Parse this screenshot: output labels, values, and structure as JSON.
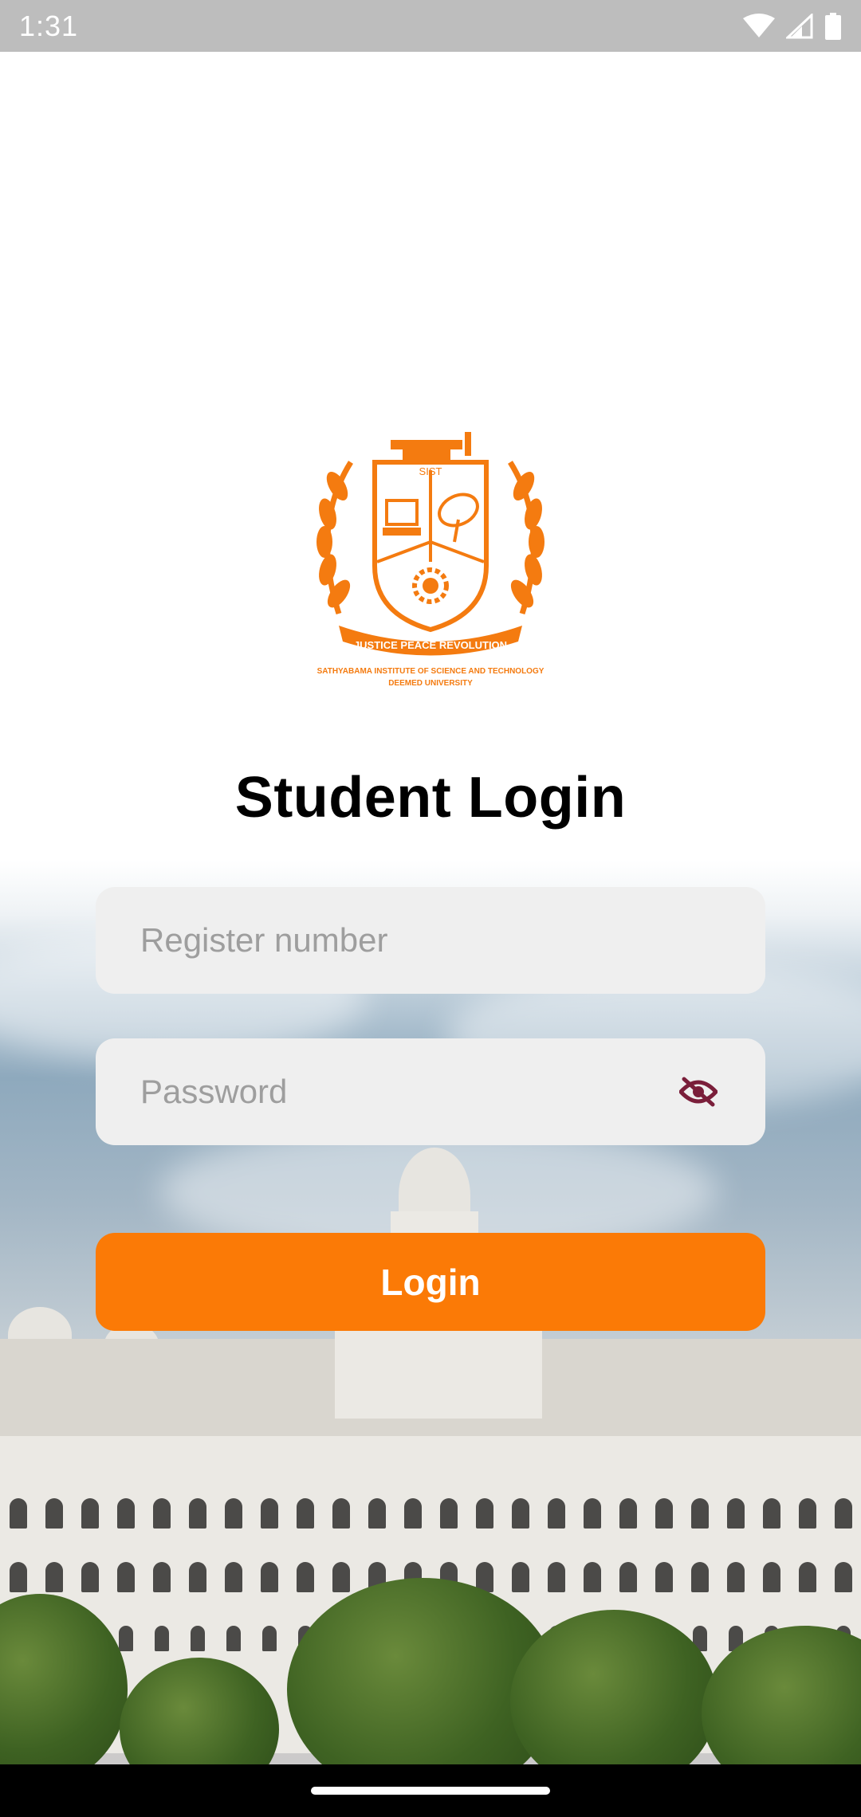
{
  "status_bar": {
    "time": "1:31",
    "icons": [
      "wifi-icon",
      "signal-icon",
      "battery-icon"
    ]
  },
  "logo": {
    "name": "university-crest-logo",
    "shield_text": "SIST",
    "motto": "JUSTICE PEACE REVOLUTION",
    "institution": "SATHYABAMA INSTITUTE OF SCIENCE AND TECHNOLOGY",
    "subtitle": "DEEMED UNIVERSITY",
    "color": "#f47b10"
  },
  "login": {
    "title": "Student Login",
    "register_placeholder": "Register number",
    "password_placeholder": "Password",
    "password_toggle_icon": "eye-off-icon",
    "button_label": "Login"
  },
  "colors": {
    "accent": "#fb7a06",
    "field_bg": "#efefef",
    "eye_icon": "#7a1e3a"
  }
}
